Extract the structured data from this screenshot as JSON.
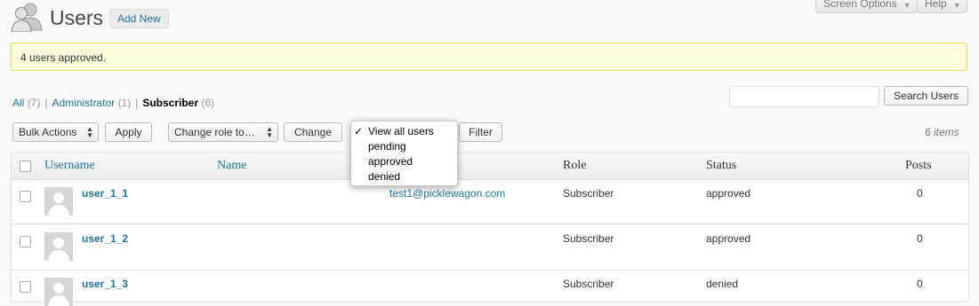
{
  "top_tabs": {
    "screen_options": "Screen Options",
    "help": "Help"
  },
  "header": {
    "title": "Users",
    "add_new": "Add New"
  },
  "notice": {
    "message": "4 users approved."
  },
  "views": {
    "all_label": "All",
    "all_count": "(7)",
    "admin_label": "Administrator",
    "admin_count": "(1)",
    "subscriber_label": "Subscriber",
    "subscriber_count": "(6)",
    "sep": "|"
  },
  "search": {
    "value": "",
    "button": "Search Users"
  },
  "bulk": {
    "selected": "Bulk Actions",
    "apply": "Apply"
  },
  "role": {
    "selected": "Change role to…",
    "change": "Change"
  },
  "filter": {
    "check_mark": "✓",
    "options": [
      "View all users",
      "pending",
      "approved",
      "denied"
    ],
    "button": "Filter"
  },
  "pagination": {
    "items": "6 items"
  },
  "table": {
    "headers": {
      "username": "Username",
      "name": "Name",
      "role": "Role",
      "status": "Status",
      "posts": "Posts"
    },
    "rows": [
      {
        "username": "user_1_1",
        "email": "test1@picklewagon.com",
        "role": "Subscriber",
        "status": "approved",
        "posts": "0"
      },
      {
        "username": "user_1_2",
        "email": "",
        "role": "Subscriber",
        "status": "approved",
        "posts": "0"
      },
      {
        "username": "user_1_3",
        "email": "",
        "role": "Subscriber",
        "status": "denied",
        "posts": "0"
      }
    ]
  },
  "colors": {
    "link": "#21759b",
    "notice_bg": "#ffffe0",
    "notice_border": "#e6db55"
  }
}
